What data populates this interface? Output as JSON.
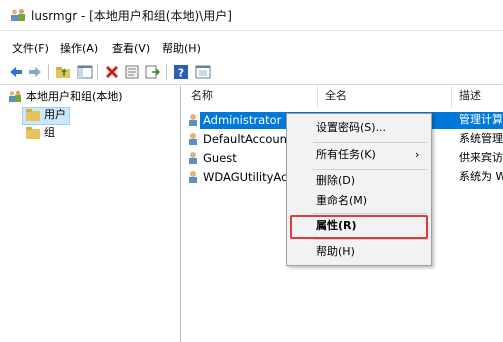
{
  "window": {
    "title": "lusrmgr - [本地用户和组(本地)\\用户]"
  },
  "menubar": {
    "items": [
      "文件(F)",
      "操作(A)",
      "查看(V)",
      "帮助(H)"
    ]
  },
  "toolbar": {
    "icons": [
      "back-arrow-icon",
      "forward-arrow-icon",
      "up-folder-icon",
      "show-hide-tree-icon",
      "delete-icon",
      "properties-sheet-icon",
      "export-list-icon",
      "help-icon",
      "view-icon"
    ],
    "colors": {
      "delete": "#cc2020",
      "arrow": "#2f77c9",
      "help": "#2d5fb8"
    }
  },
  "tree": {
    "root": "本地用户和组(本地)",
    "children": [
      {
        "label": "用户",
        "selected": true
      },
      {
        "label": "组",
        "selected": false
      }
    ]
  },
  "list": {
    "columns": [
      "名称",
      "全名",
      "描述"
    ],
    "rows": [
      {
        "name": "Administrator",
        "desc": "管理计算",
        "selected": true
      },
      {
        "name": "DefaultAccount",
        "desc": "系统管理",
        "selected": false
      },
      {
        "name": "Guest",
        "desc": "供来宾访",
        "selected": false
      },
      {
        "name": "WDAGUtilityAcc",
        "desc": "系统为 W",
        "selected": false
      }
    ]
  },
  "context_menu": {
    "items": [
      {
        "label": "设置密码(S)...",
        "submenu": false,
        "bold": false
      },
      {
        "label": "所有任务(K)",
        "submenu": true,
        "bold": false
      },
      {
        "label": "删除(D)",
        "submenu": false,
        "bold": false
      },
      {
        "label": "重命名(M)",
        "submenu": false,
        "bold": false
      },
      {
        "label": "属性(R)",
        "submenu": false,
        "bold": true
      },
      {
        "label": "帮助(H)",
        "submenu": false,
        "bold": false
      }
    ],
    "submenu_arrow": "›",
    "highlight_color": "#e03a3a"
  },
  "colors": {
    "selection": "#0078d7",
    "tree_selection": "#cce8ff"
  }
}
